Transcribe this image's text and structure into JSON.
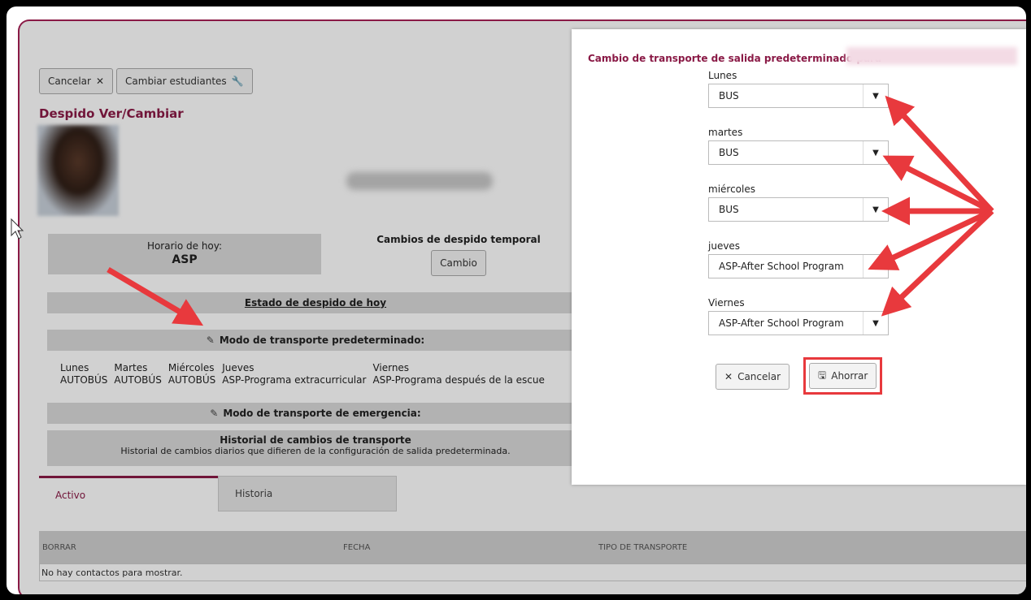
{
  "toolbar": {
    "cancel_label": "Cancelar",
    "change_students_label": "Cambiar estudiantes"
  },
  "page_title": "Despido Ver/Cambiar",
  "schedule": {
    "label": "Horario de hoy:",
    "value": "ASP"
  },
  "temp_changes": {
    "label": "Cambios de despido temporal",
    "button": "Cambio"
  },
  "status_bar": "Estado de despido de hoy",
  "default_mode_bar": "Modo de transporte predeterminado:",
  "days_table": {
    "headers": [
      "Lunes",
      "Martes",
      "Miércoles",
      "Jueves",
      "Viernes"
    ],
    "values": [
      "AUTOBÚS",
      "AUTOBÚS",
      "AUTOBÚS",
      "ASP-Programa extracurricular",
      "ASP-Programa después de la escue"
    ]
  },
  "emergency_mode_bar": "Modo de transporte de emergencia:",
  "history": {
    "title": "Historial de cambios de transporte",
    "subtitle": "Historial de cambios diarios que difieren de la configuración de salida predeterminada."
  },
  "tabs": [
    {
      "label": "Activo"
    },
    {
      "label": "Historia"
    }
  ],
  "grid": {
    "columns": [
      "BORRAR",
      "FECHA",
      "TIPO DE TRANSPORTE"
    ],
    "empty": "No hay contactos para mostrar."
  },
  "modal": {
    "title": "Cambio de transporte de salida predeterminado para",
    "fields": [
      {
        "label": "Lunes",
        "value": "BUS"
      },
      {
        "label": "martes",
        "value": "BUS"
      },
      {
        "label": "miércoles",
        "value": "BUS"
      },
      {
        "label": "jueves",
        "value": "ASP-After School Program"
      },
      {
        "label": "Viernes",
        "value": "ASP-After School Program"
      }
    ],
    "cancel_label": "Cancelar",
    "save_label": "Ahorrar"
  },
  "colors": {
    "accent": "#8a1a46",
    "annotation": "#e8393d"
  }
}
